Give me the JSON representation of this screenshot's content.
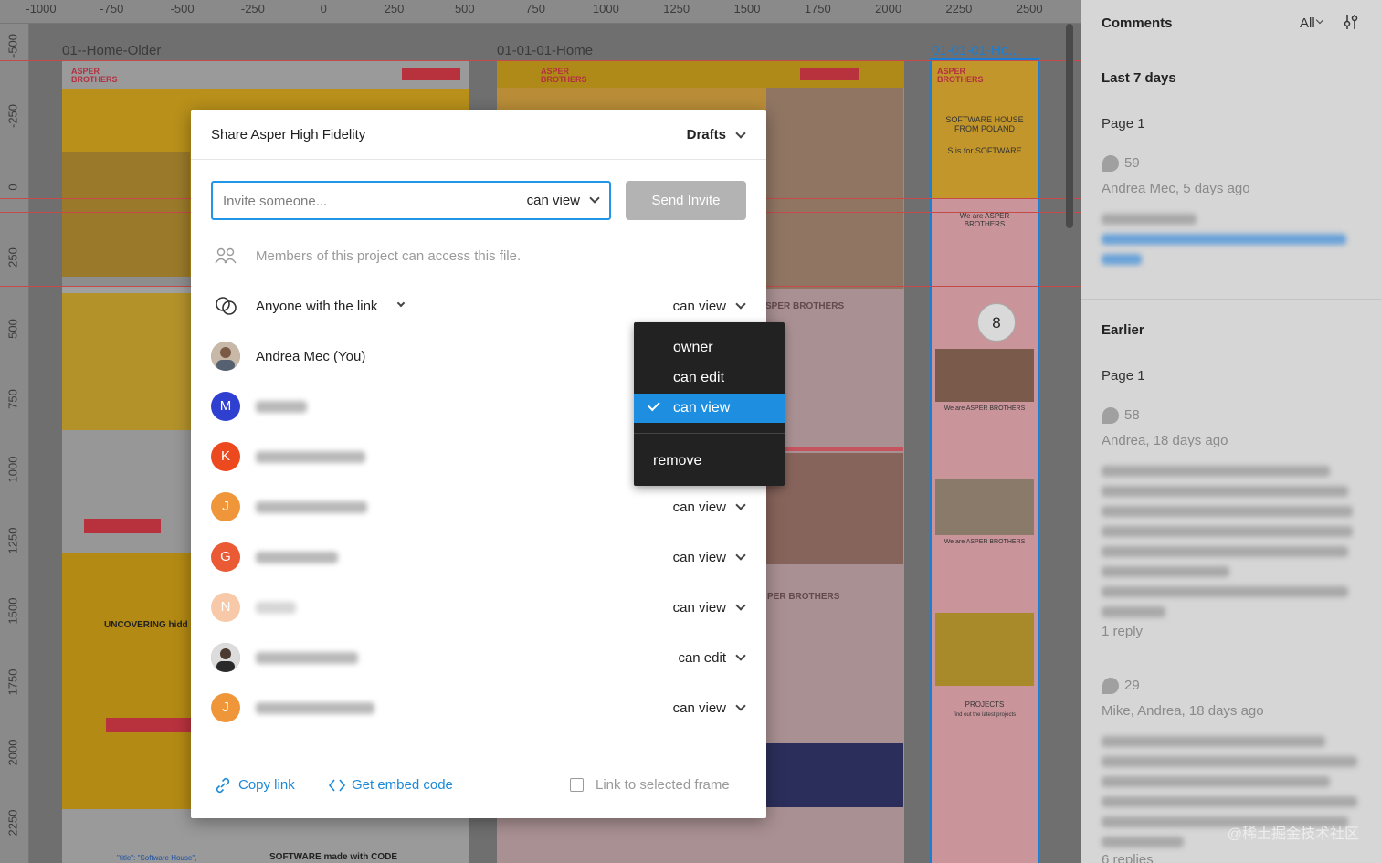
{
  "ruler": {
    "x_ticks": [
      "-1000",
      "-750",
      "-500",
      "-250",
      "0",
      "250",
      "500",
      "750",
      "1000",
      "1250",
      "1500",
      "1750",
      "2000",
      "2250",
      "2500"
    ],
    "y_ticks": [
      "-500",
      "-250",
      "0",
      "250",
      "500",
      "750",
      "1000",
      "1250",
      "1500",
      "1750",
      "2000",
      "2250"
    ]
  },
  "frames": {
    "older": "01--Home-Older",
    "home": "01-01-01-Home",
    "mobile": "01-01-01-Ho..."
  },
  "canvas_text": {
    "logo": "ASPER\nBROTHERS",
    "software_house": "SOFTWARE HOUSE\nFROM POLAND",
    "s_is_for": "S is for SOFTWARE",
    "we_are": "We are ASPER\nBROTHERS",
    "we_are_2": "We are ASPER BROTHERS",
    "projects": "PROJECTS",
    "find_out": "find out the latest projects",
    "uncovering": "UNCOVERING hidd",
    "asper_brothers_a": "SPER BROTHERS",
    "asper_brothers_b": "PER BROTHERS",
    "software_made": "SOFTWARE made with CODE",
    "code_line": "\"title\": \"Software House\",",
    "pin_number": "8"
  },
  "modal": {
    "title": "Share Asper High Fidelity",
    "team": "Drafts",
    "invite_placeholder": "Invite someone...",
    "invite_permission": "can view",
    "send_button": "Send Invite",
    "members_note": "Members of this project can access this file.",
    "link_access": "Anyone with the link",
    "link_permission": "can view",
    "people": [
      {
        "initial": "",
        "name": "Andrea Mec (You)",
        "permission": "",
        "color": "#9a8a7a"
      },
      {
        "initial": "M",
        "name": "",
        "permission": "",
        "color": "#2f3fd0"
      },
      {
        "initial": "K",
        "name": "",
        "permission": "",
        "color": "#ec4a1e"
      },
      {
        "initial": "J",
        "name": "",
        "permission": "can view",
        "color": "#f0963a"
      },
      {
        "initial": "G",
        "name": "",
        "permission": "can view",
        "color": "#ea5a34"
      },
      {
        "initial": "N",
        "name": "",
        "permission": "can view",
        "color": "#f8c9a8"
      },
      {
        "initial": "",
        "name": "",
        "permission": "can edit",
        "color": "#6a6a6a"
      },
      {
        "initial": "J",
        "name": "",
        "permission": "can view",
        "color": "#f0963a"
      }
    ],
    "copy_link": "Copy link",
    "embed_code": "Get embed code",
    "link_selected_frame": "Link to selected frame"
  },
  "dropdown": {
    "items": [
      "owner",
      "can edit",
      "can view"
    ],
    "selected": "can view",
    "remove": "remove"
  },
  "comments": {
    "title": "Comments",
    "filter": "All",
    "section_recent": "Last 7 days",
    "section_earlier": "Earlier",
    "threads": [
      {
        "page": "Page 1",
        "number": "59",
        "meta": "Andrea Mec, 5 days ago",
        "replies": ""
      },
      {
        "page": "Page 1",
        "number": "58",
        "meta": "Andrea, 18 days ago",
        "replies": "1 reply"
      },
      {
        "page": "",
        "number": "29",
        "meta": "Mike, Andrea, 18 days ago",
        "replies": "6 replies"
      }
    ]
  },
  "watermark": "@稀土掘金技术社区"
}
